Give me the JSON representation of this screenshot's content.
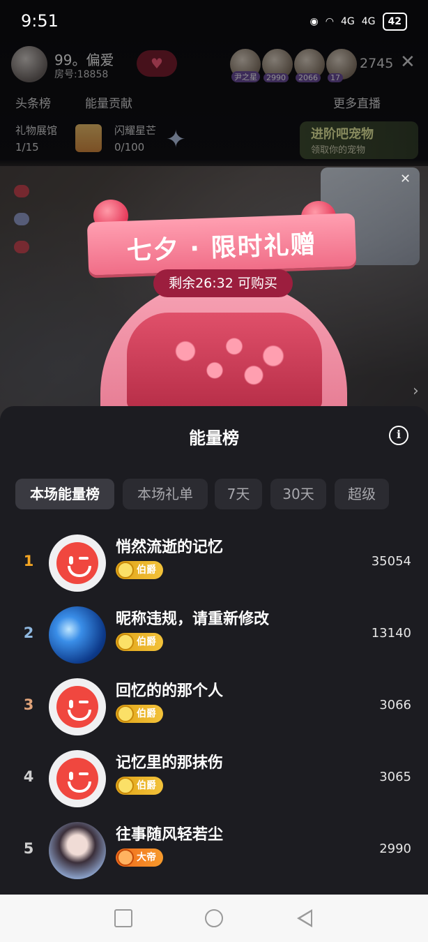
{
  "status_bar": {
    "time": "9:51",
    "battery": "42",
    "network_1": "4G",
    "network_2": "4G"
  },
  "room": {
    "host_name": "99。偏爱",
    "room_number": "房号:18858",
    "viewer_badges": [
      "尹之星",
      "2990",
      "2066",
      "17"
    ],
    "viewer_count": "2745",
    "tab_headlines": "头条榜",
    "tab_energy": "能量贡献",
    "more_live": "更多直播",
    "gallery_label": "礼物展馆",
    "gallery_value": "1/15",
    "star_label": "闪耀星芒",
    "star_value": "0/100",
    "pet_title": "进阶吧宠物",
    "pet_subtitle": "领取你的宠物"
  },
  "promo": {
    "title": "七夕 · 限时礼赠",
    "timer": "剩余26:32 可购买"
  },
  "panel": {
    "title": "能量榜",
    "filters": [
      {
        "label": "本场能量榜",
        "active": true
      },
      {
        "label": "本场礼单",
        "active": false
      },
      {
        "label": "7天",
        "active": false
      },
      {
        "label": "30天",
        "active": false
      },
      {
        "label": "超级",
        "active": false
      }
    ],
    "ranks": [
      {
        "rank": "1",
        "name": "悄然流逝的记忆",
        "badge": "伯爵",
        "score": "35054",
        "rank_color": "#f5a623"
      },
      {
        "rank": "2",
        "name": "昵称违规，请重新修改",
        "badge": "伯爵",
        "score": "13140",
        "rank_color": "#8fb8e0"
      },
      {
        "rank": "3",
        "name": "回忆的的那个人",
        "badge": "伯爵",
        "score": "3066",
        "rank_color": "#e0a37a"
      },
      {
        "rank": "4",
        "name": "记忆里的那抹伤",
        "badge": "伯爵",
        "score": "3065",
        "rank_color": "#cfcfcf"
      },
      {
        "rank": "5",
        "name": "往事随风轻若尘",
        "badge": "大帝",
        "score": "2990",
        "rank_color": "#cfcfcf"
      }
    ]
  }
}
